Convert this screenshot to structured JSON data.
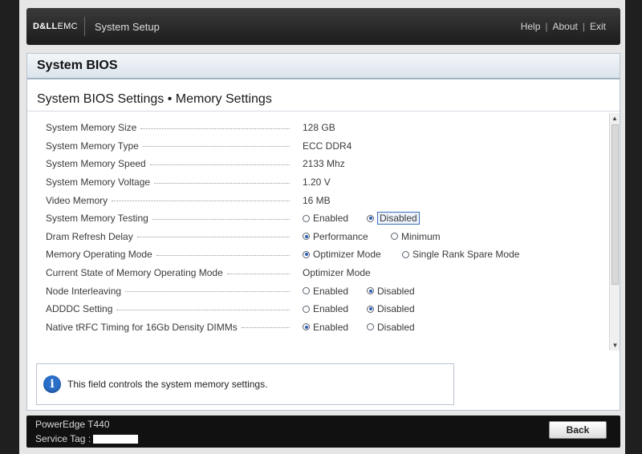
{
  "header": {
    "brand_dell": "D&LL",
    "brand_emc": "EMC",
    "app_title": "System Setup",
    "links": [
      "Help",
      "About",
      "Exit"
    ],
    "separator": "|"
  },
  "panel": {
    "title": "System BIOS",
    "subtitle": "System BIOS Settings • Memory Settings"
  },
  "settings": [
    {
      "label": "System Memory Size",
      "value": "128 GB"
    },
    {
      "label": "System Memory Type",
      "value": "ECC DDR4"
    },
    {
      "label": "System Memory Speed",
      "value": "2133 Mhz"
    },
    {
      "label": "System Memory Voltage",
      "value": "1.20 V"
    },
    {
      "label": "Video Memory",
      "value": "16 MB"
    },
    {
      "label": "System Memory Testing",
      "options": [
        {
          "text": "Enabled",
          "selected": false
        },
        {
          "text": "Disabled",
          "selected": true,
          "focused": true
        }
      ]
    },
    {
      "label": "Dram Refresh Delay",
      "options": [
        {
          "text": "Performance",
          "selected": true
        },
        {
          "text": "Minimum",
          "selected": false
        }
      ]
    },
    {
      "label": "Memory Operating Mode",
      "options": [
        {
          "text": "Optimizer Mode",
          "selected": true
        },
        {
          "text": "Single Rank Spare Mode",
          "selected": false
        }
      ]
    },
    {
      "label": "Current State of Memory Operating Mode",
      "value": "Optimizer Mode"
    },
    {
      "label": "Node Interleaving",
      "options": [
        {
          "text": "Enabled",
          "selected": false
        },
        {
          "text": "Disabled",
          "selected": true
        }
      ]
    },
    {
      "label": "ADDDC Setting",
      "options": [
        {
          "text": "Enabled",
          "selected": false
        },
        {
          "text": "Disabled",
          "selected": true
        }
      ]
    },
    {
      "label": "Native tRFC Timing for 16Gb Density DIMMs",
      "options": [
        {
          "text": "Enabled",
          "selected": true
        },
        {
          "text": "Disabled",
          "selected": false
        }
      ]
    }
  ],
  "help": {
    "icon": "info-icon",
    "text": "This field controls the system memory settings."
  },
  "footer": {
    "model": "PowerEdge T440",
    "service_tag_label": "Service Tag :",
    "back_label": "Back"
  },
  "colors": {
    "radio_selected": "#2c5db3",
    "info_icon": "#2a6fc9",
    "header_bg": "#1c1c1c"
  }
}
